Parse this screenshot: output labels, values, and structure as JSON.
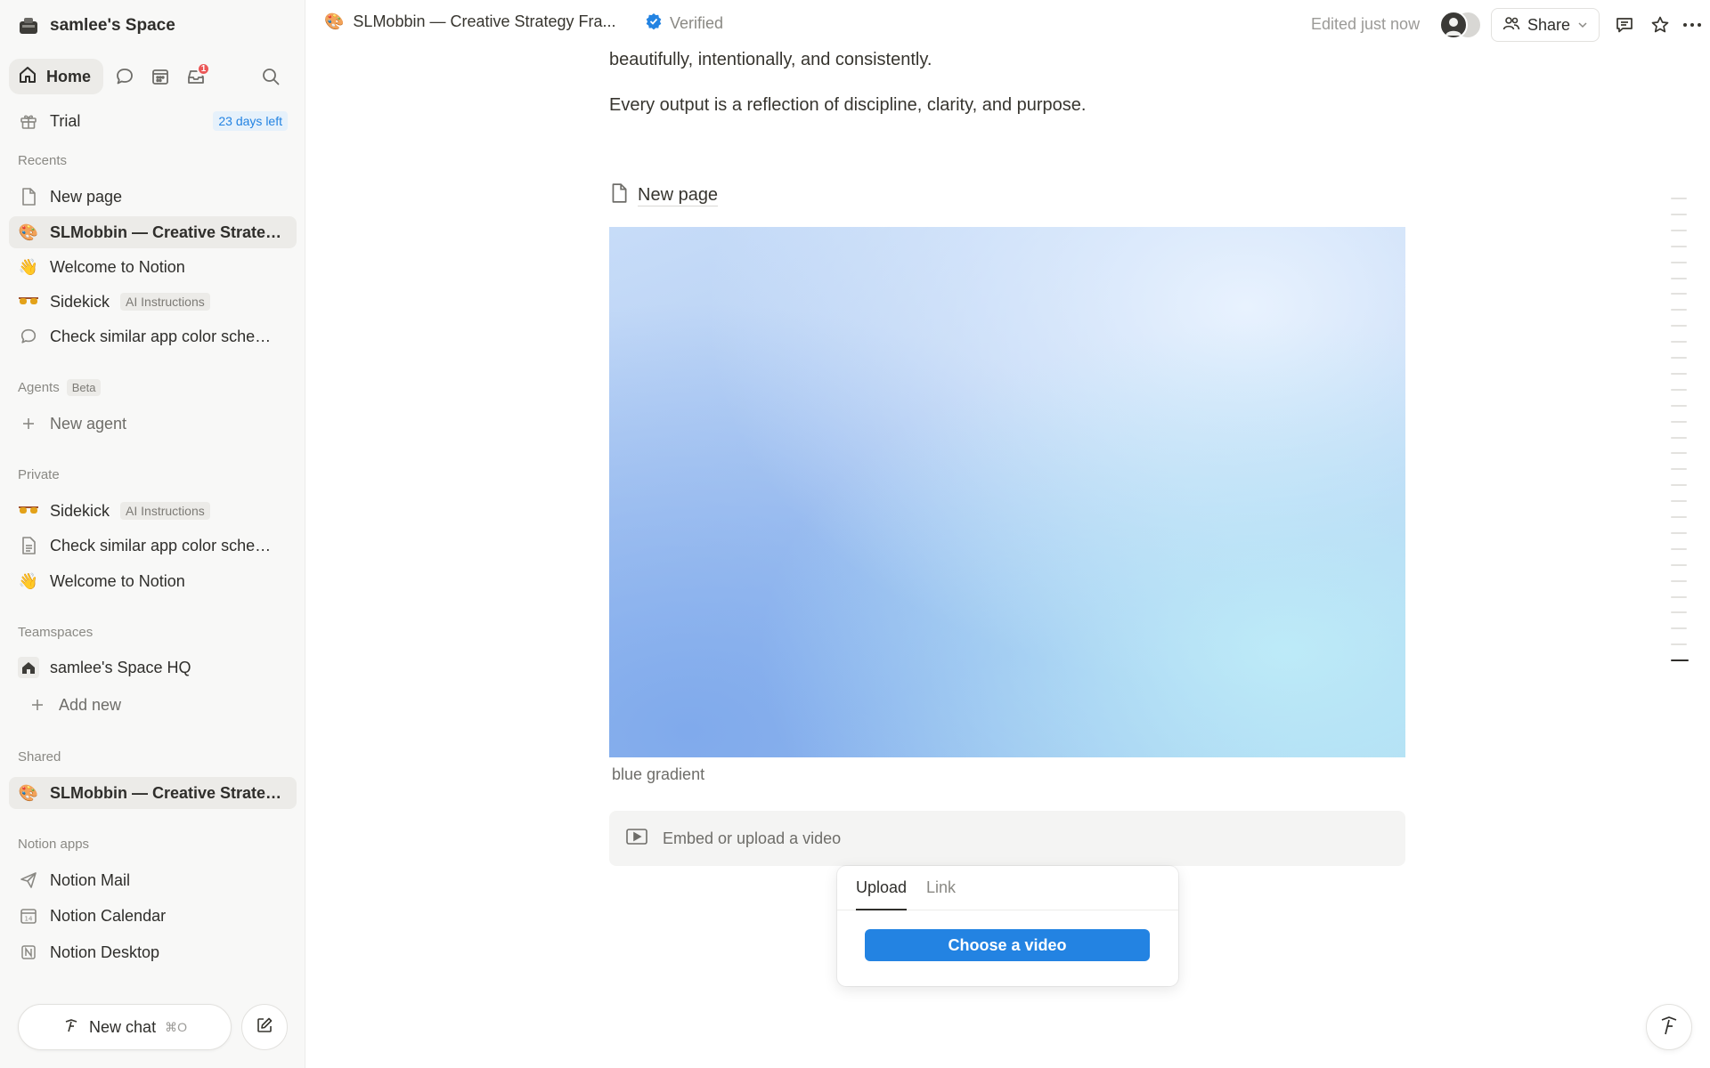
{
  "workspace": {
    "name": "samlee's Space"
  },
  "nav": {
    "home_label": "Home",
    "inbox_badge": "1"
  },
  "trial": {
    "label": "Trial",
    "days_left": "23 days left"
  },
  "recents": {
    "title": "Recents",
    "items": [
      {
        "label": "New page",
        "icon": "page-icon"
      },
      {
        "label": "SLMobbin — Creative Strategy Framework",
        "icon": "palette-emoji"
      },
      {
        "label": "Welcome to Notion",
        "icon": "wave-emoji"
      },
      {
        "label": "Sidekick",
        "tag": "AI Instructions",
        "icon": "sunglasses-emoji"
      },
      {
        "label": "Check similar app color schemes",
        "icon": "chat-bubble-icon"
      }
    ]
  },
  "agents": {
    "title": "Agents",
    "beta": "Beta",
    "new_agent": "New agent"
  },
  "private": {
    "title": "Private",
    "items": [
      {
        "label": "Sidekick",
        "tag": "AI Instructions",
        "icon": "sunglasses-emoji"
      },
      {
        "label": "Check similar app color schemes",
        "icon": "document-icon"
      },
      {
        "label": "Welcome to Notion",
        "icon": "wave-emoji"
      }
    ]
  },
  "teamspaces": {
    "title": "Teamspaces",
    "items": [
      {
        "label": "samlee's Space HQ",
        "icon": "house-icon"
      }
    ],
    "add_new": "Add new"
  },
  "shared": {
    "title": "Shared",
    "items": [
      {
        "label": "SLMobbin — Creative Strategy Framework",
        "icon": "palette-emoji"
      }
    ]
  },
  "apps": {
    "title": "Notion apps",
    "items": [
      {
        "label": "Notion Mail",
        "icon": "mail-send-icon"
      },
      {
        "label": "Notion Calendar",
        "icon": "calendar-icon"
      },
      {
        "label": "Notion Desktop",
        "icon": "notion-logo-icon"
      }
    ]
  },
  "new_chat": {
    "label": "New chat",
    "shortcut": "⌘O"
  },
  "topbar": {
    "page_title": "SLMobbin — Creative Strategy Fra...",
    "verified": "Verified",
    "edited": "Edited just now",
    "share": "Share"
  },
  "content": {
    "para1": "beautifully, intentionally, and consistently.",
    "para2": "Every output is a reflection of discipline, clarity, and purpose.",
    "subpage": "New page",
    "image_caption": "blue gradient",
    "embed_placeholder": "Embed or upload a video"
  },
  "popover": {
    "tabs": [
      "Upload",
      "Link"
    ],
    "active_tab": "Upload",
    "button": "Choose a video"
  },
  "colors": {
    "accent": "#2383e2",
    "sidebar_bg": "#f8f8f7",
    "badge": "#eb5757"
  }
}
